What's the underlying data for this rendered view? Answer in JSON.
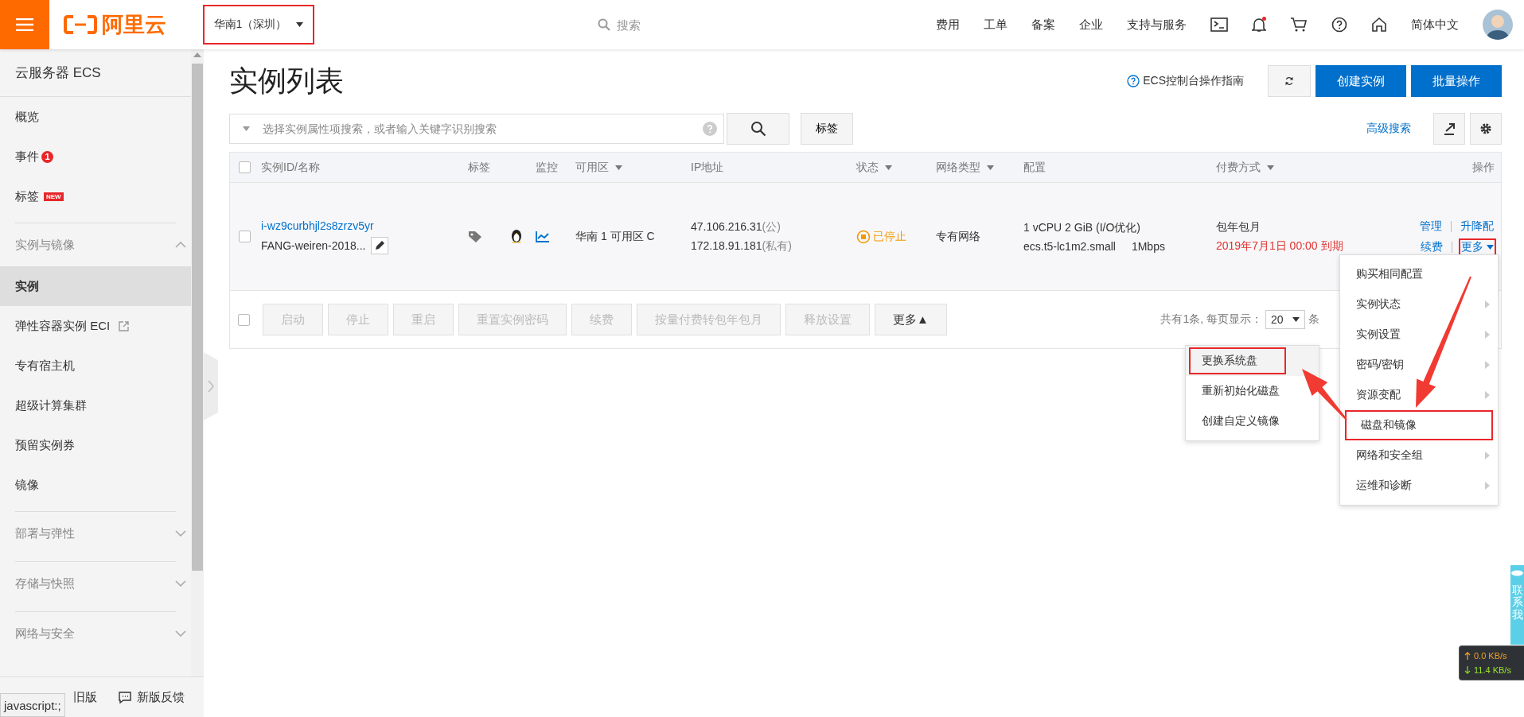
{
  "topbar": {
    "logo_text": "阿里云",
    "region": {
      "label": "华南1（深圳）",
      "annotated": true
    },
    "search_placeholder": "搜索",
    "nav": [
      "费用",
      "工单",
      "备案",
      "企业",
      "支持与服务"
    ],
    "notification_dot": true,
    "language": "简体中文"
  },
  "sidebar": {
    "title": "云服务器 ECS",
    "items": [
      {
        "kind": "link",
        "label": "概览",
        "selected": false
      },
      {
        "kind": "link",
        "label": "事件",
        "badge": "1",
        "selected": false
      },
      {
        "kind": "link",
        "label": "标签",
        "tag": "NEW",
        "selected": false
      },
      {
        "kind": "group",
        "label": "实例与镜像",
        "expanded": true,
        "children": [
          {
            "label": "实例",
            "selected": true,
            "external": false
          },
          {
            "label": "弹性容器实例 ECI",
            "selected": false,
            "external": true
          },
          {
            "label": "专有宿主机",
            "selected": false,
            "external": false
          },
          {
            "label": "超级计算集群",
            "selected": false,
            "external": false
          },
          {
            "label": "预留实例券",
            "selected": false,
            "external": false
          },
          {
            "label": "镜像",
            "selected": false,
            "external": false
          }
        ]
      },
      {
        "kind": "group",
        "label": "部署与弹性",
        "expanded": false
      },
      {
        "kind": "group",
        "label": "存储与快照",
        "expanded": false
      },
      {
        "kind": "group",
        "label": "网络与安全",
        "expanded": false
      }
    ],
    "footer": [
      "旧版",
      "新版反馈"
    ]
  },
  "status_tooltip": "javascript:;",
  "main": {
    "title": "实例列表",
    "guide_link": "ECS控制台操作指南",
    "primary_buttons": [
      "创建实例",
      "批量操作"
    ],
    "search": {
      "placeholder": "选择实例属性项搜索，或者输入关键字识别搜索"
    },
    "tag_button": "标签",
    "advanced_search": "高级搜索",
    "table": {
      "header_checked": false,
      "columns": [
        {
          "label": "实例ID/名称",
          "sortable": false
        },
        {
          "label": "标签",
          "sortable": false
        },
        {
          "label": "监控",
          "sortable": false
        },
        {
          "label": "可用区",
          "sortable": true
        },
        {
          "label": "IP地址",
          "sortable": false
        },
        {
          "label": "状态",
          "sortable": true
        },
        {
          "label": "网络类型",
          "sortable": true
        },
        {
          "label": "配置",
          "sortable": false
        },
        {
          "label": "付费方式",
          "sortable": true
        },
        {
          "label": "操作",
          "sortable": false
        }
      ],
      "rows": [
        {
          "checked": false,
          "id": "i-wz9curbhjl2s8zrzv5yr",
          "name": "FANG-weiren-2018...",
          "zone": "华南 1 可用区 C",
          "ip_public": "47.106.216.31",
          "ip_public_suffix": "(公)",
          "ip_private": "172.18.91.181",
          "ip_private_suffix": "(私有)",
          "status": {
            "label": "已停止",
            "kind": "stopped"
          },
          "network": "专有网络",
          "config": "1 vCPU 2 GiB (I/O优化)",
          "instance_type": "ecs.t5-lc1m2.small",
          "bandwidth": "1Mbps",
          "billing": "包年包月",
          "expiry": "2019年7月1日 00:00 到期",
          "actions": [
            {
              "label": "管理",
              "annotated": false,
              "dropdown": false
            },
            {
              "label": "升降配",
              "annotated": false,
              "dropdown": false
            },
            {
              "label": "续费",
              "annotated": false,
              "dropdown": false
            },
            {
              "label": "更多",
              "annotated": true,
              "dropdown": true
            }
          ]
        }
      ]
    },
    "bulk": {
      "checked": false,
      "buttons": [
        {
          "label": "启动",
          "disabled": true
        },
        {
          "label": "停止",
          "disabled": true
        },
        {
          "label": "重启",
          "disabled": true
        },
        {
          "label": "重置实例密码",
          "disabled": true
        },
        {
          "label": "续费",
          "disabled": true
        },
        {
          "label": "按量付费转包年包月",
          "disabled": true
        },
        {
          "label": "释放设置",
          "disabled": true
        },
        {
          "label": "更多▲",
          "disabled": false
        }
      ]
    },
    "pagination": {
      "summary": "共有1条, 每页显示：",
      "page_size": "20",
      "unit": "条"
    },
    "more_menu": [
      {
        "label": "购买相同配置",
        "submenu": false,
        "annotated": false
      },
      {
        "label": "实例状态",
        "submenu": true,
        "annotated": false
      },
      {
        "label": "实例设置",
        "submenu": true,
        "annotated": false
      },
      {
        "label": "密码/密钥",
        "submenu": true,
        "annotated": false
      },
      {
        "label": "资源变配",
        "submenu": true,
        "annotated": false
      },
      {
        "label": "磁盘和镜像",
        "submenu": false,
        "annotated": true
      },
      {
        "label": "网络和安全组",
        "submenu": true,
        "annotated": false
      },
      {
        "label": "运维和诊断",
        "submenu": true,
        "annotated": false
      }
    ],
    "submenu": [
      {
        "label": "更换系统盘",
        "selected": true,
        "annotated": true
      },
      {
        "label": "重新初始化磁盘",
        "selected": false,
        "annotated": false
      },
      {
        "label": "创建自定义镜像",
        "selected": false,
        "annotated": false
      }
    ]
  },
  "contact_tab": "联系我",
  "net_speed": {
    "up": "0.0 KB/s",
    "down": "11.4 KB/s"
  }
}
